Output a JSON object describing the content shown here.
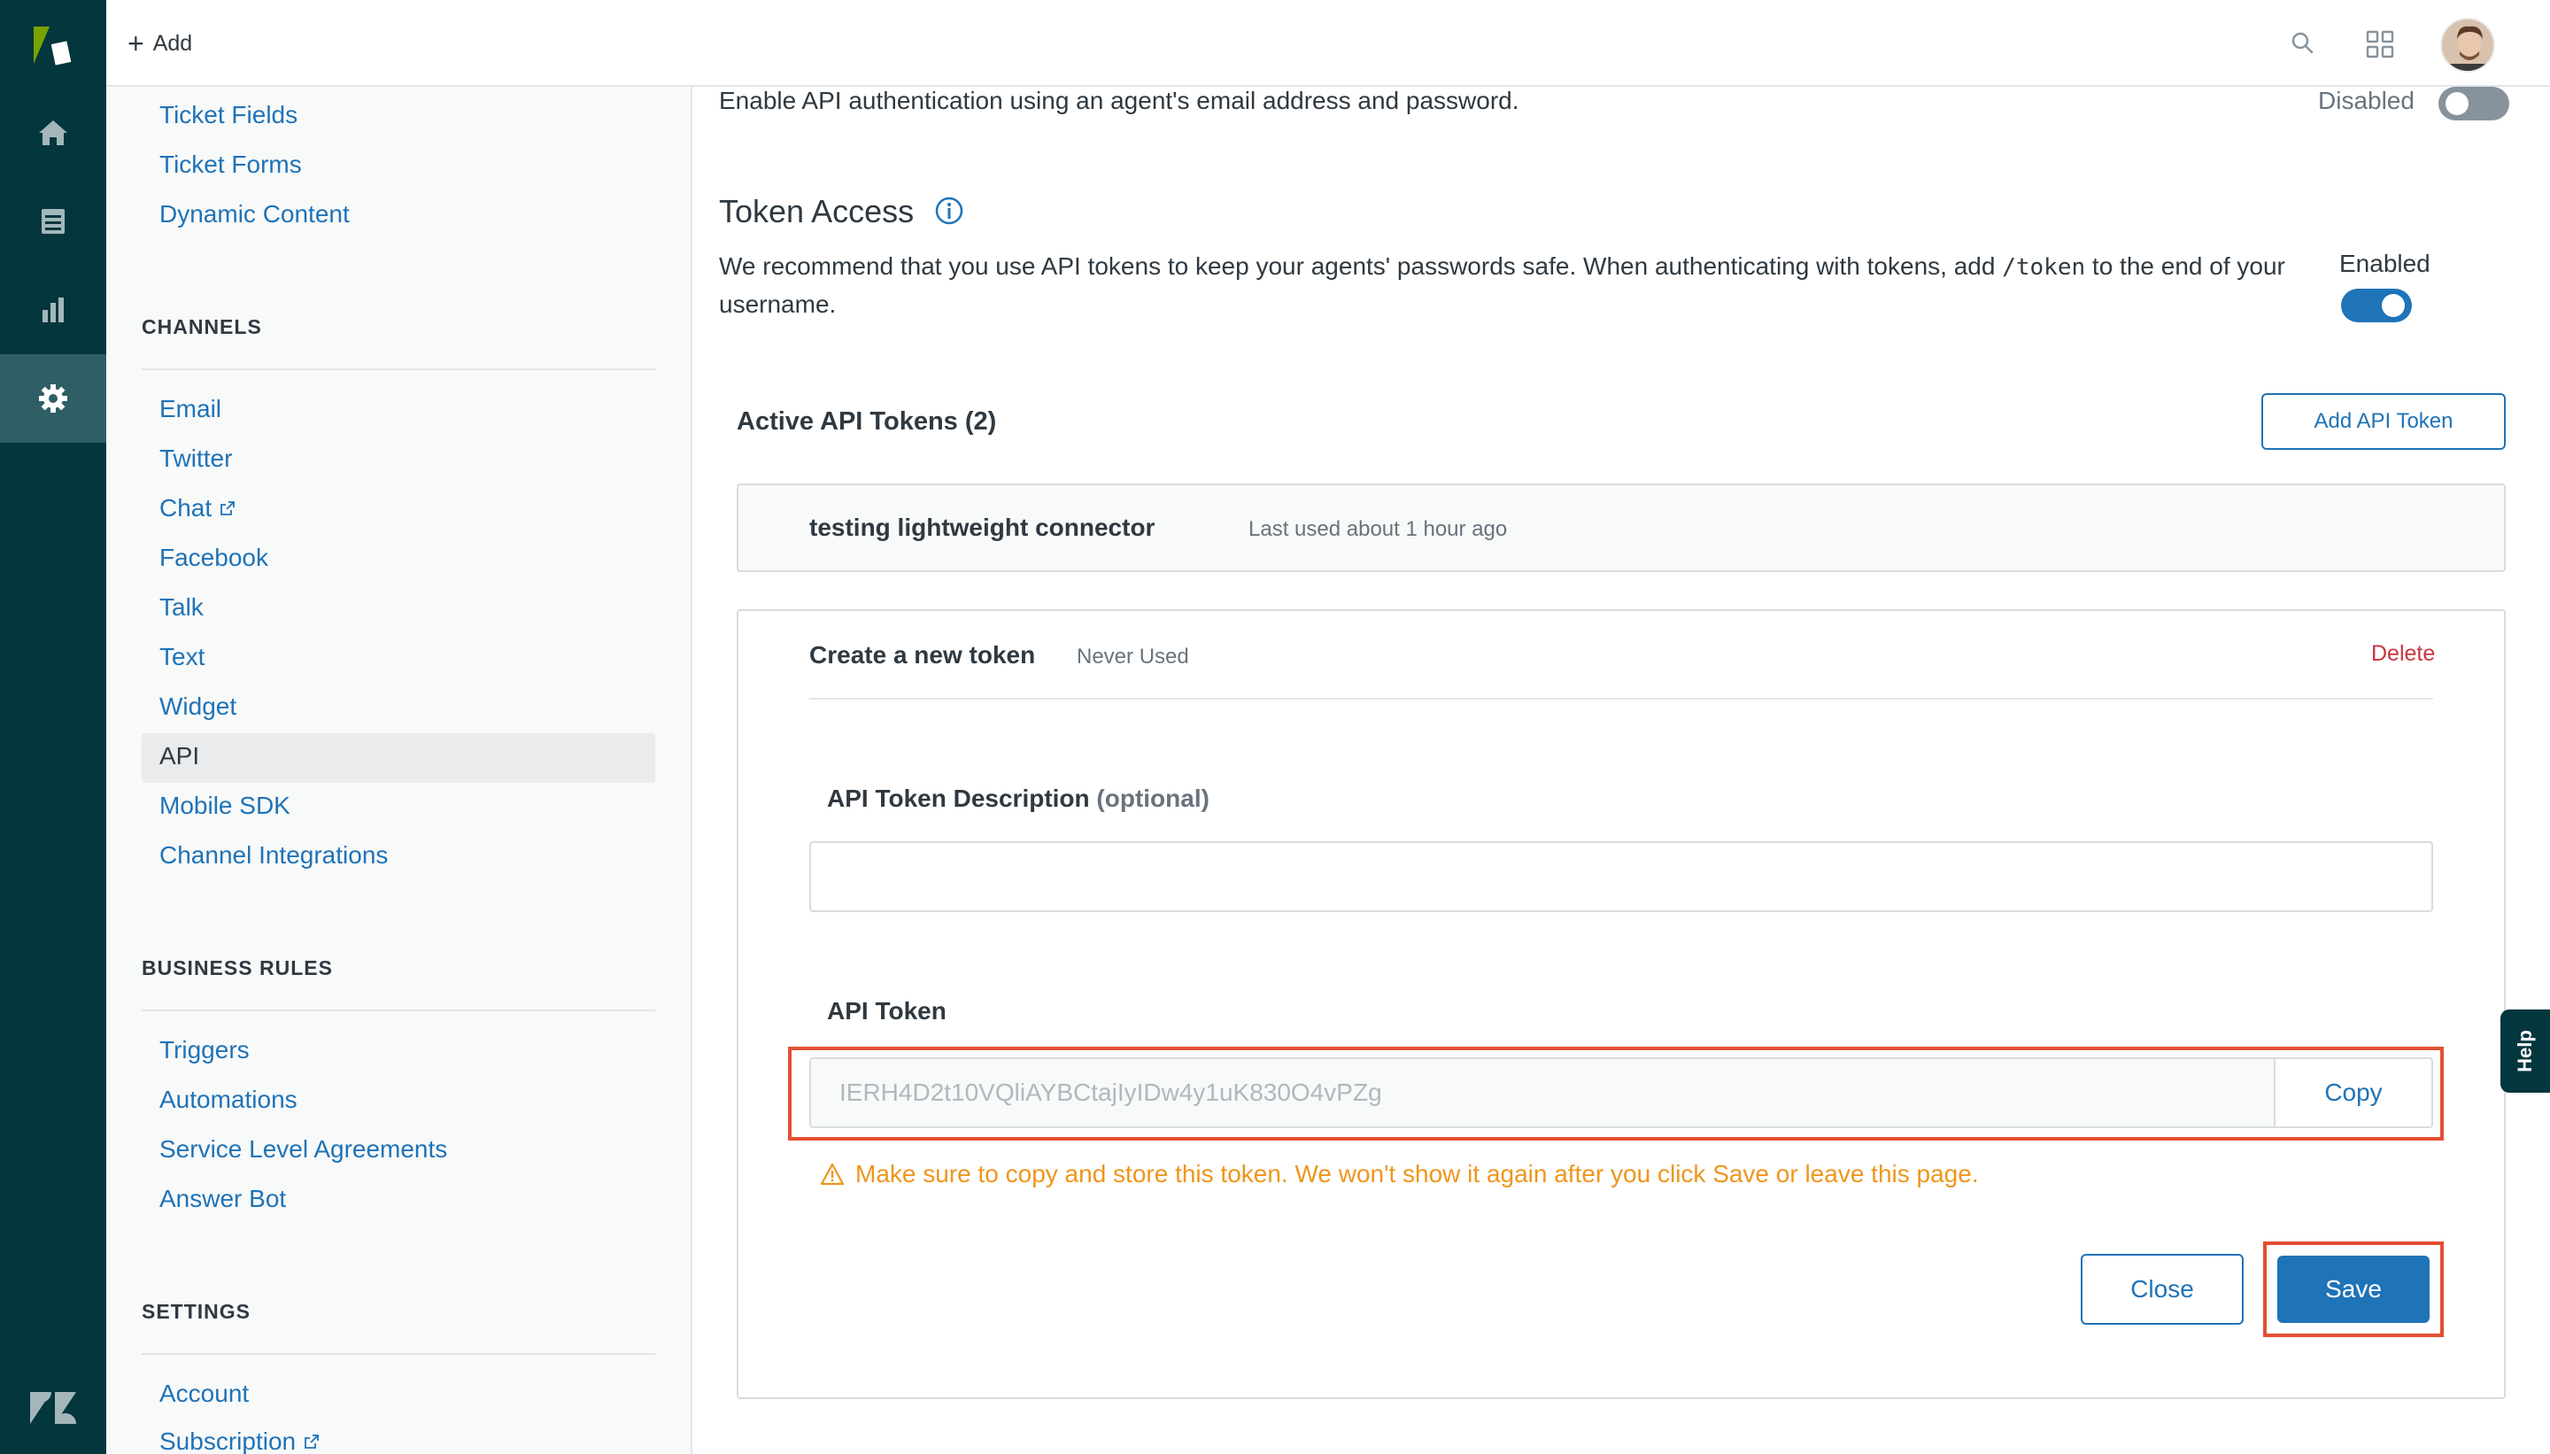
{
  "topbar": {
    "add_label": "Add"
  },
  "sidebar": {
    "objects_links": [
      "Ticket Fields",
      "Ticket Forms",
      "Dynamic Content"
    ],
    "channels_head": "CHANNELS",
    "channels_links": [
      "Email",
      "Twitter",
      "Chat",
      "Facebook",
      "Talk",
      "Text",
      "Widget",
      "API",
      "Mobile SDK",
      "Channel Integrations"
    ],
    "business_head": "BUSINESS RULES",
    "business_links": [
      "Triggers",
      "Automations",
      "Service Level Agreements",
      "Answer Bot"
    ],
    "settings_head": "SETTINGS",
    "settings_links": [
      "Account",
      "Subscription"
    ],
    "active_item": "API"
  },
  "main": {
    "basic_auth_desc": "Enable API authentication using an agent's email address and password.",
    "basic_auth_status": "Disabled",
    "token_access_title": "Token Access",
    "token_access_desc_pre": "We recommend that you use API tokens to keep your agents' passwords safe. When authenticating with tokens, add ",
    "token_access_code": "/token",
    "token_access_desc_post": " to the end of your username.",
    "token_access_status": "Enabled",
    "active_tokens_head": "Active API Tokens (2)",
    "add_token_label": "Add API Token",
    "existing_token": {
      "name": "testing lightweight connector",
      "meta": "Last used about 1 hour ago"
    },
    "new_token": {
      "title": "Create a new token",
      "meta": "Never Used",
      "delete_label": "Delete",
      "desc_label": "API Token Description",
      "desc_optional": "(optional)",
      "desc_value": "",
      "api_label": "API Token",
      "api_value": "IERH4D2t10VQliAYBCtajIyIDw4y1uK830O4vPZg",
      "copy_label": "Copy",
      "warning": "Make sure to copy and store this token. We won't show it again after you click Save or leave this page.",
      "close_label": "Close",
      "save_label": "Save"
    }
  },
  "help_label": "Help",
  "colors": {
    "rail": "#03363d",
    "link": "#1f73b7",
    "warning": "#ed961c",
    "delete": "#cc3340",
    "highlight": "#e34f32"
  }
}
